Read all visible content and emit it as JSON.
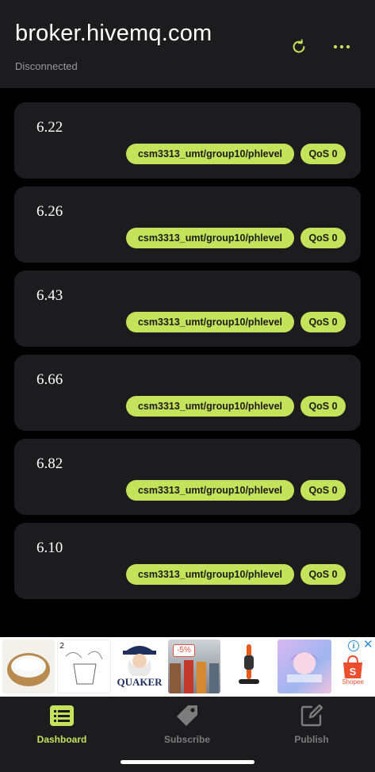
{
  "header": {
    "title": "broker.hivemq.com",
    "status": "Disconnected",
    "refresh_icon": "refresh-icon",
    "more_icon": "more-horizontal-icon",
    "accent": "#c4e35a"
  },
  "messages": [
    {
      "value": "6.22",
      "topic": "csm3313_umt/group10/phlevel",
      "qos": "QoS 0"
    },
    {
      "value": "6.26",
      "topic": "csm3313_umt/group10/phlevel",
      "qos": "QoS 0"
    },
    {
      "value": "6.43",
      "topic": "csm3313_umt/group10/phlevel",
      "qos": "QoS 0"
    },
    {
      "value": "6.66",
      "topic": "csm3313_umt/group10/phlevel",
      "qos": "QoS 0"
    },
    {
      "value": "6.82",
      "topic": "csm3313_umt/group10/phlevel",
      "qos": "QoS 0"
    },
    {
      "value": "6.10",
      "topic": "csm3313_umt/group10/phlevel",
      "qos": "QoS 0"
    }
  ],
  "ad": {
    "info_icon": "info-icon",
    "close_icon": "close-icon",
    "discount": "-5%",
    "brand": "QUAKER",
    "store": "Shopee",
    "number": "2"
  },
  "tabs": [
    {
      "label": "Dashboard",
      "icon": "dashboard-list-icon",
      "active": true
    },
    {
      "label": "Subscribe",
      "icon": "tag-icon",
      "active": false
    },
    {
      "label": "Publish",
      "icon": "edit-square-icon",
      "active": false
    }
  ]
}
